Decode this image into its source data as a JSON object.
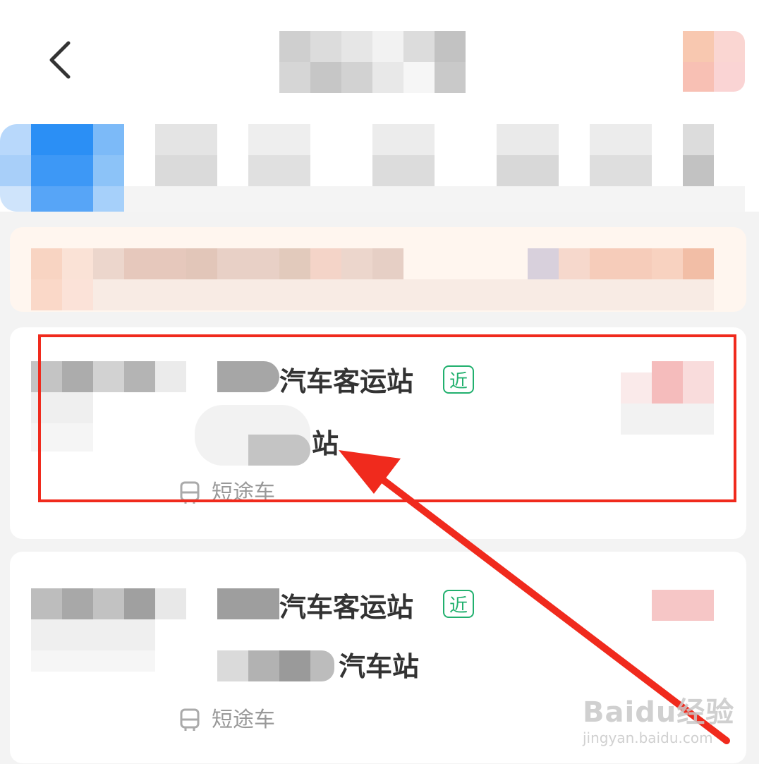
{
  "header": {
    "back_icon": "chevron-left-icon"
  },
  "results": [
    {
      "origin_suffix": "汽车客运站",
      "near_badge": "近",
      "destination_suffix": "站",
      "trip_type": "短途车",
      "trip_icon": "bus-icon"
    },
    {
      "origin_suffix": "汽车客运站",
      "near_badge": "近",
      "destination_suffix": "汽车站",
      "trip_type": "短途车",
      "trip_icon": "bus-icon"
    }
  ],
  "annotation": {
    "color": "#f02a1d"
  },
  "watermark": {
    "logo": "Baidu经验",
    "site": "jingyan.baidu.com"
  },
  "colors": {
    "accent_blue": "#2b8ff5",
    "near_green": "#21b06e",
    "highlight_red": "#f02a1d"
  }
}
